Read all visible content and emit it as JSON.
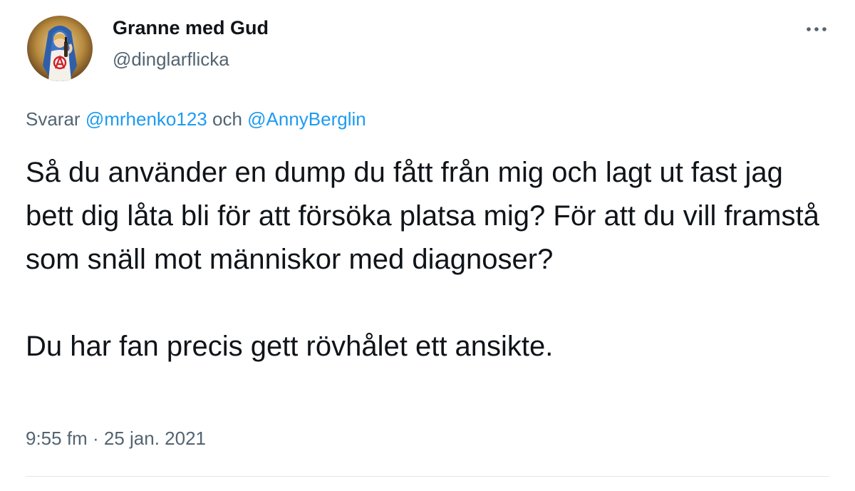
{
  "author": {
    "display_name": "Granne med Gud",
    "handle": "@dinglarflicka",
    "avatar_icon": "profile-avatar"
  },
  "more_icon": "more-options-icon",
  "reply": {
    "prefix": "Svarar",
    "mention_1": "@mrhenko123",
    "joiner": "och",
    "mention_2": "@AnnyBerglin"
  },
  "tweet": {
    "paragraph_1": "Så du använder en dump du fått från mig och lagt ut fast jag bett dig låta bli för att försöka platsa mig? För att du vill framstå som snäll mot människor med diagnoser?",
    "paragraph_2": "Du har fan precis gett rövhålet ett ansikte."
  },
  "meta": {
    "time": "9:55 fm",
    "separator": "·",
    "date": "25 jan. 2021"
  },
  "colors": {
    "text": "#0f1419",
    "secondary": "#536471",
    "link": "#1d9bf0",
    "divider": "#e1e6ea"
  }
}
